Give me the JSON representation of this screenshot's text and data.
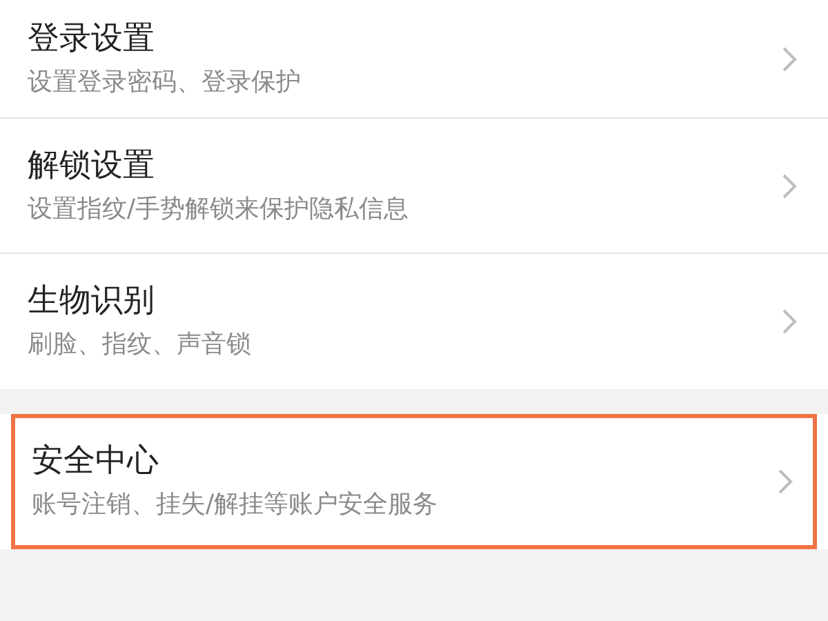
{
  "groups": [
    {
      "items": [
        {
          "title": "登录设置",
          "subtitle": "设置登录密码、登录保护",
          "highlighted": false
        },
        {
          "title": "解锁设置",
          "subtitle": "设置指纹/手势解锁来保护隐私信息",
          "highlighted": false
        },
        {
          "title": "生物识别",
          "subtitle": "刷脸、指纹、声音锁",
          "highlighted": false
        }
      ]
    },
    {
      "items": [
        {
          "title": "安全中心",
          "subtitle": "账号注销、挂失/解挂等账户安全服务",
          "highlighted": true
        }
      ]
    }
  ]
}
